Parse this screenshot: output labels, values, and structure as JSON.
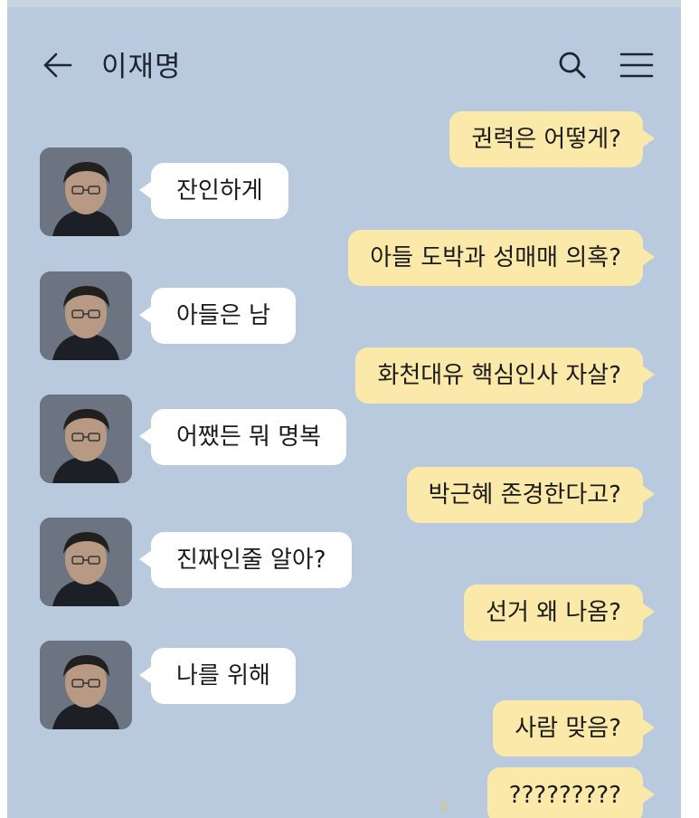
{
  "header": {
    "title": "이재명",
    "back_icon": "arrow-left-icon",
    "search_icon": "search-icon",
    "menu_icon": "hamburger-menu-icon"
  },
  "colors": {
    "chat_background": "#b9cadf",
    "my_bubble": "#fbe9a9",
    "their_bubble": "#ffffff"
  },
  "messages": [
    {
      "sender": "me",
      "text": "권력은 어떻게?"
    },
    {
      "sender": "them",
      "text": "잔인하게"
    },
    {
      "sender": "me",
      "text": "아들 도박과 성매매 의혹?"
    },
    {
      "sender": "them",
      "text": "아들은 남"
    },
    {
      "sender": "me",
      "text": "화천대유 핵심인사 자살?"
    },
    {
      "sender": "them",
      "text": "어쨌든 뭐 명복"
    },
    {
      "sender": "me",
      "text": "박근혜 존경한다고?"
    },
    {
      "sender": "them",
      "text": "진짜인줄 알아?"
    },
    {
      "sender": "me",
      "text": "선거 왜 나옴?"
    },
    {
      "sender": "them",
      "text": "나를 위해"
    },
    {
      "sender": "me",
      "text": "사람 맞음?"
    },
    {
      "sender": "me",
      "text": "?????????"
    }
  ],
  "unread_count": "1"
}
